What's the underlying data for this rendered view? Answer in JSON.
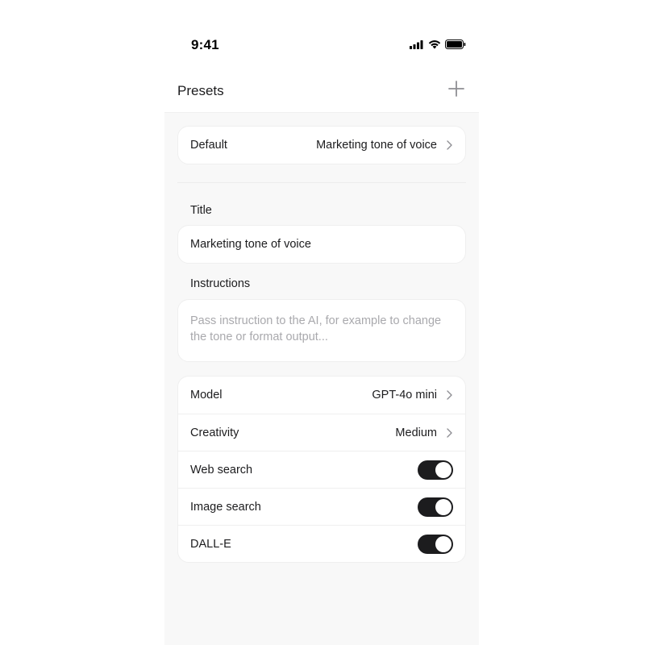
{
  "status_bar": {
    "time": "9:41",
    "icons": [
      "cellular-signal-icon",
      "wifi-icon",
      "battery-icon"
    ]
  },
  "header": {
    "title": "Presets",
    "add_icon": "plus-icon"
  },
  "default_row": {
    "label": "Default",
    "value": "Marketing tone of voice",
    "icon": "chevron-right-icon"
  },
  "title_section": {
    "label": "Title",
    "value": "Marketing tone of voice"
  },
  "instructions_section": {
    "label": "Instructions",
    "placeholder": "Pass instruction to the AI, for example to change the tone or format output..."
  },
  "settings": {
    "model": {
      "label": "Model",
      "value": "GPT-4o mini"
    },
    "creativity": {
      "label": "Creativity",
      "value": "Medium"
    },
    "web_search": {
      "label": "Web search",
      "enabled": true
    },
    "image_search": {
      "label": "Image search",
      "enabled": true
    },
    "dalle": {
      "label": "DALL-E",
      "enabled": true
    }
  },
  "colors": {
    "background": "#f8f8f8",
    "card": "#ffffff",
    "toggle_on": "#1c1c1e",
    "placeholder": "#a9a9ad"
  }
}
